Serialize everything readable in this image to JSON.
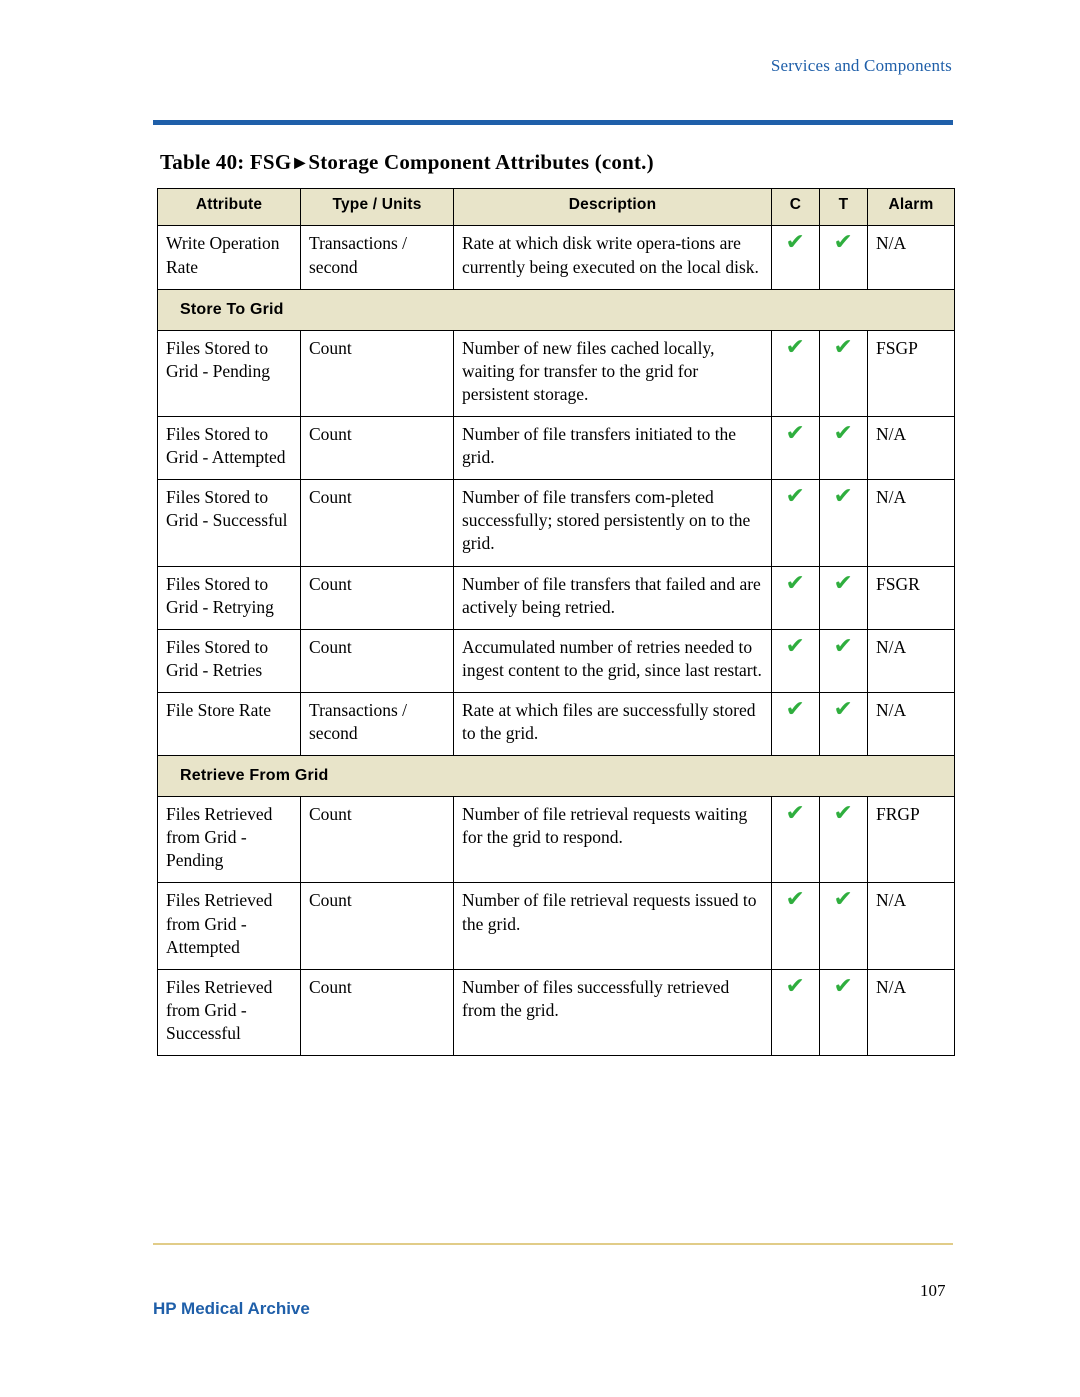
{
  "header": {
    "running_head": "Services and Components"
  },
  "title": {
    "prefix": "Table 40: FSG",
    "triangle": "▶",
    "suffix": "Storage Component Attributes (cont.)"
  },
  "table": {
    "columns": [
      "Attribute",
      "Type / Units",
      "Description",
      "C",
      "T",
      "Alarm"
    ],
    "check_glyph": "✔",
    "rows": [
      {
        "kind": "data",
        "attribute": "Write Operation Rate",
        "type": "Transactions / second",
        "description": "Rate at which disk write opera-tions are currently being executed on the local disk.",
        "c": true,
        "t": true,
        "alarm": "N/A"
      },
      {
        "kind": "section",
        "label": "Store To Grid"
      },
      {
        "kind": "data",
        "attribute": "Files Stored to Grid - Pending",
        "type": "Count",
        "description": "Number of new files cached locally, waiting for transfer to the grid for persistent storage.",
        "c": true,
        "t": true,
        "alarm": "FSGP"
      },
      {
        "kind": "data",
        "attribute": "Files Stored to Grid - Attempted",
        "type": "Count",
        "description": "Number of file transfers initiated to the grid.",
        "c": true,
        "t": true,
        "alarm": "N/A"
      },
      {
        "kind": "data",
        "attribute": "Files Stored to Grid - Successful",
        "type": "Count",
        "description": "Number of file transfers com-pleted successfully; stored persistently on to the grid.",
        "c": true,
        "t": true,
        "alarm": "N/A"
      },
      {
        "kind": "data",
        "attribute": "Files Stored to Grid - Retrying",
        "type": "Count",
        "description": "Number of file transfers that failed and are actively being retried.",
        "c": true,
        "t": true,
        "alarm": "FSGR"
      },
      {
        "kind": "data",
        "attribute": "Files Stored to Grid - Retries",
        "type": "Count",
        "description": "Accumulated number of retries needed to ingest content to the grid, since last restart.",
        "c": true,
        "t": true,
        "alarm": "N/A"
      },
      {
        "kind": "data",
        "attribute": "File Store Rate",
        "type": "Transactions / second",
        "description": "Rate at which files are successfully stored to the grid.",
        "c": true,
        "t": true,
        "alarm": "N/A"
      },
      {
        "kind": "section",
        "label": "Retrieve From Grid"
      },
      {
        "kind": "data",
        "attribute": "Files Retrieved from Grid - Pending",
        "type": "Count",
        "description": "Number of file retrieval requests waiting for the grid to respond.",
        "c": true,
        "t": true,
        "alarm": "FRGP"
      },
      {
        "kind": "data",
        "attribute": "Files Retrieved from Grid - Attempted",
        "type": "Count",
        "description": "Number of file retrieval requests issued to the grid.",
        "c": true,
        "t": true,
        "alarm": "N/A"
      },
      {
        "kind": "data",
        "attribute": "Files Retrieved from Grid - Successful",
        "type": "Count",
        "description": "Number of files successfully retrieved from the grid.",
        "c": true,
        "t": true,
        "alarm": "N/A"
      }
    ]
  },
  "footer": {
    "product": "HP Medical Archive",
    "page_number": "107"
  },
  "colors": {
    "accent_blue": "#1f5fa9",
    "header_fill": "#e8e4c9",
    "check_green": "#2fae3e",
    "rule_gold": "#c9a227"
  }
}
